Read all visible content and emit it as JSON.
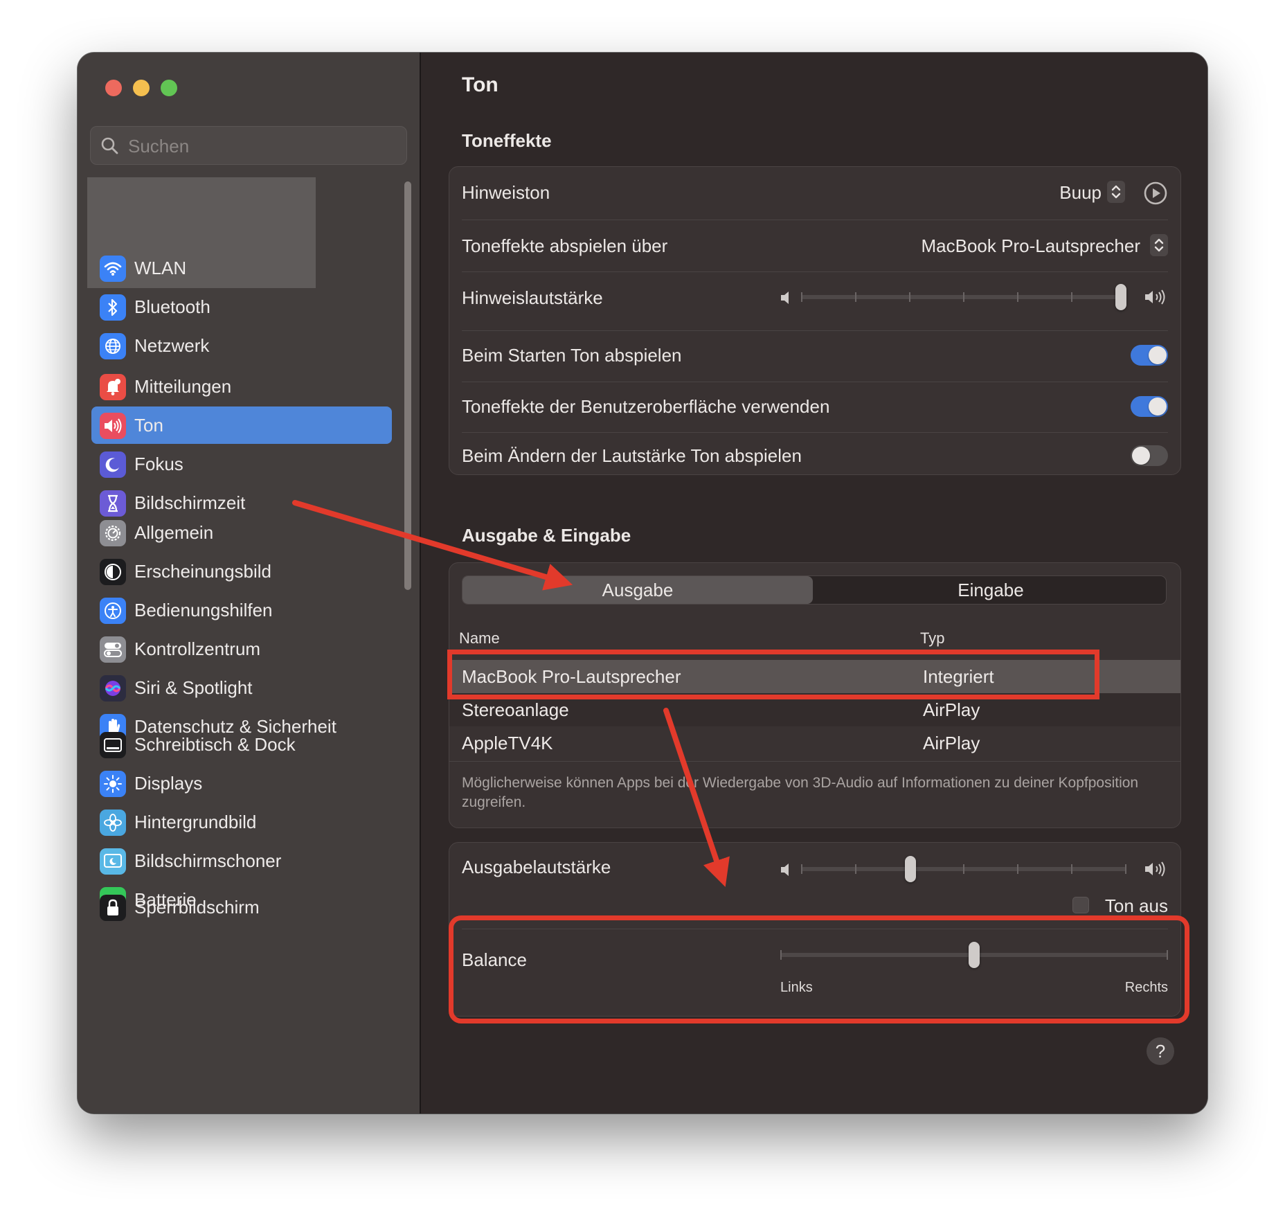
{
  "window": {
    "search_placeholder": "Suchen",
    "title": "Ton"
  },
  "sidebar": {
    "groups": [
      [
        {
          "label": "WLAN",
          "icon": "wifi-icon",
          "color": "#3b82f6"
        },
        {
          "label": "Bluetooth",
          "icon": "bluetooth-icon",
          "color": "#3b82f6"
        },
        {
          "label": "Netzwerk",
          "icon": "globe-icon",
          "color": "#3b82f6"
        }
      ],
      [
        {
          "label": "Mitteilungen",
          "icon": "bell-icon",
          "color": "#ea4d45"
        },
        {
          "label": "Ton",
          "icon": "speaker-icon",
          "color": "#ea4d5f",
          "selected": true
        },
        {
          "label": "Fokus",
          "icon": "moon-icon",
          "color": "#5b5bd6"
        },
        {
          "label": "Bildschirmzeit",
          "icon": "hourglass-icon",
          "color": "#6c5bd6"
        }
      ],
      [
        {
          "label": "Allgemein",
          "icon": "gear-icon",
          "color": "#8e8e93"
        },
        {
          "label": "Erscheinungsbild",
          "icon": "appearance-icon",
          "color": "#1c1c1e"
        },
        {
          "label": "Bedienungshilfen",
          "icon": "accessibility-icon",
          "color": "#3b82f6"
        },
        {
          "label": "Kontrollzentrum",
          "icon": "toggles-icon",
          "color": "#8e8e93"
        },
        {
          "label": "Siri & Spotlight",
          "icon": "siri-icon",
          "color": "#2c2c40"
        },
        {
          "label": "Datenschutz & Sicherheit",
          "icon": "hand-icon",
          "color": "#3b82f6"
        }
      ],
      [
        {
          "label": "Schreibtisch & Dock",
          "icon": "dock-icon",
          "color": "#1c1c1e"
        },
        {
          "label": "Displays",
          "icon": "sun-icon",
          "color": "#3b82f6"
        },
        {
          "label": "Hintergrundbild",
          "icon": "flower-icon",
          "color": "#4aa7e0"
        },
        {
          "label": "Bildschirmschoner",
          "icon": "screensaver-icon",
          "color": "#59b8e6"
        },
        {
          "label": "Batterie",
          "icon": "battery-icon",
          "color": "#34c759"
        }
      ],
      [
        {
          "label": "Sperrbildschirm",
          "icon": "lock-icon",
          "color": "#1c1c1e"
        }
      ]
    ]
  },
  "toneffekte": {
    "title": "Toneffekte",
    "alert_sound_label": "Hinweiston",
    "alert_sound_value": "Buup",
    "play_through_label": "Toneffekte abspielen über",
    "play_through_value": "MacBook Pro-Lautsprecher",
    "alert_volume_label": "Hinweislautstärke",
    "alert_volume_level": 1.0,
    "startup_sound_label": "Beim Starten Ton abspielen",
    "startup_sound_on": true,
    "ui_effects_label": "Toneffekte der Benutzeroberfläche verwenden",
    "ui_effects_on": true,
    "volume_feedback_label": "Beim Ändern der Lautstärke Ton abspielen",
    "volume_feedback_on": false
  },
  "io": {
    "title": "Ausgabe & Eingabe",
    "tabs": [
      "Ausgabe",
      "Eingabe"
    ],
    "active_tab": "Ausgabe",
    "columns": [
      "Name",
      "Typ"
    ],
    "devices": [
      {
        "name": "MacBook Pro-Lautsprecher",
        "type": "Integriert",
        "selected": true
      },
      {
        "name": "Stereoanlage",
        "type": "AirPlay"
      },
      {
        "name": "AppleTV4K",
        "type": "AirPlay"
      }
    ],
    "footnote": "Möglicherweise können Apps bei der Wiedergabe von 3D-Audio auf Informationen zu deiner Kopfposition zugreifen."
  },
  "output": {
    "volume_label": "Ausgabelautstärke",
    "volume_level": 0.33,
    "mute_label": "Ton aus",
    "muted": false,
    "balance_label": "Balance",
    "balance_level": 0.5,
    "balance_left": "Links",
    "balance_right": "Rechts"
  },
  "help_label": "?",
  "colors": {
    "accent": "#3f79dc",
    "selection": "#4f86d9",
    "annotation": "#e23a2b"
  }
}
